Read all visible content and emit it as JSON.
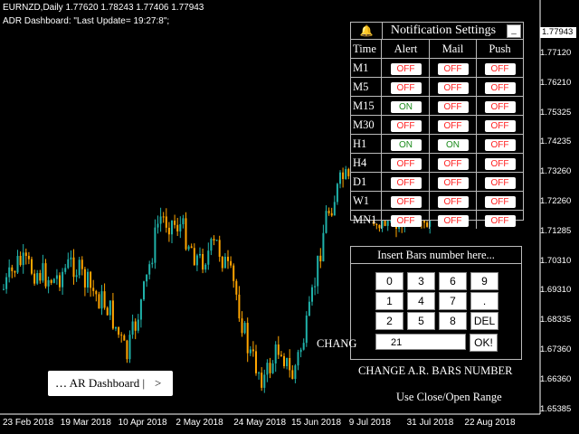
{
  "header": {
    "line1": "EURNZD,Daily  1.77620 1.78243 1.77406 1.77943",
    "line2": "ADR Dashboard: \"Last Update= 19:27:8\";"
  },
  "price_axis": {
    "current": "1.77943",
    "labels": [
      "1.77120",
      "1.76210",
      "1.75325",
      "1.74235",
      "1.73260",
      "1.72260",
      "1.71285",
      "1.70310",
      "1.69310",
      "1.68335",
      "1.67360",
      "1.66360",
      "1.65385"
    ]
  },
  "date_axis": [
    "23 Feb 2018",
    "19 Mar 2018",
    "10 Apr 2018",
    "2 May 2018",
    "24 May 2018",
    "15 Jun 2018",
    "9 Jul 2018",
    "31 Jul 2018",
    "22 Aug 2018"
  ],
  "notification": {
    "bell_icon": "bell-icon",
    "title": "Notification Settings",
    "minimize_label": "_",
    "headers": {
      "time": "Time",
      "alert": "Alert",
      "mail": "Mail",
      "push": "Push"
    },
    "rows": [
      {
        "tf": "M1",
        "alert": "OFF",
        "mail": "OFF",
        "push": "OFF"
      },
      {
        "tf": "M5",
        "alert": "OFF",
        "mail": "OFF",
        "push": "OFF"
      },
      {
        "tf": "M15",
        "alert": "ON",
        "mail": "OFF",
        "push": "OFF"
      },
      {
        "tf": "M30",
        "alert": "OFF",
        "mail": "OFF",
        "push": "OFF"
      },
      {
        "tf": "H1",
        "alert": "ON",
        "mail": "ON",
        "push": "OFF"
      },
      {
        "tf": "H4",
        "alert": "OFF",
        "mail": "OFF",
        "push": "OFF"
      },
      {
        "tf": "D1",
        "alert": "OFF",
        "mail": "OFF",
        "push": "OFF"
      },
      {
        "tf": "W1",
        "alert": "OFF",
        "mail": "OFF",
        "push": "OFF"
      },
      {
        "tf": "MN1",
        "alert": "OFF",
        "mail": "OFF",
        "push": "OFF"
      }
    ]
  },
  "keypad": {
    "title": "Insert Bars number here...",
    "keys": [
      "0",
      "3",
      "6",
      "9",
      "1",
      "4",
      "7",
      ".",
      "2",
      "5",
      "8",
      "DEL"
    ],
    "input_value": "21",
    "ok_label": "OK!"
  },
  "labels": {
    "change_partial": "CHANG",
    "change_bars": "CHANGE A.R. BARS NUMBER",
    "use_close_open": "Use Close/Open Range"
  },
  "adr_button": {
    "label": "․․․ AR Dashboard  |",
    "arrow": ">"
  },
  "colors": {
    "bull": "#20b2aa",
    "bear": "#ffa500",
    "background": "#000000"
  }
}
